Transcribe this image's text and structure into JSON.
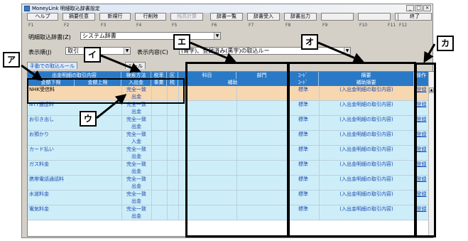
{
  "window": {
    "title": "MoneyLink 明細取込辞書設定"
  },
  "toolbar": {
    "keys": [
      {
        "label": "ヘルプ",
        "fkey": "F1"
      },
      {
        "label": "摘要任意",
        "fkey": "F2"
      },
      {
        "label": "新規行",
        "fkey": "F3"
      },
      {
        "label": "行削除",
        "fkey": "F4"
      },
      {
        "label": "残高計算",
        "fkey": "F5",
        "disabled": true
      },
      {
        "label": "辞書一覧",
        "fkey": "F6"
      },
      {
        "label": "辞書受入",
        "fkey": "F7"
      },
      {
        "label": "辞書出力",
        "fkey": "F8"
      },
      {
        "label": "",
        "fkey": "F9"
      },
      {
        "label": "",
        "fkey": "F10"
      },
      {
        "label": "",
        "fkey": "F11"
      },
      {
        "label": "終了",
        "fkey": "F12"
      }
    ]
  },
  "form": {
    "dict_label": "明細取込辞書(Z)",
    "dict_value": "システム辞書",
    "order_label": "表示順(J)",
    "order_value": "取引",
    "content_label": "表示内容(C)",
    "content_value": "(青字)、登録済み(黒字)の取込ルー"
  },
  "tabs": {
    "tab1": "手動での取込ルール",
    "tab2": "ルール"
  },
  "grid": {
    "header_top": [
      "出金明細の取引内容",
      "検索方法",
      "税率",
      "区",
      "科目",
      "部門",
      "ｺｰﾄﾞ",
      "摘要",
      "操作"
    ],
    "header_bottom": [
      "金額下限",
      "金額上限",
      "入出金",
      "事業",
      "税",
      "補助",
      "ｺｰﾄﾞ",
      "補助摘要"
    ],
    "rows": [
      {
        "name": "NHK受信料",
        "method": "完全一致",
        "io": "出金",
        "code": "標準",
        "desc": "(入出金明細の取引内容)",
        "op": "登録"
      },
      {
        "name": "NTT通話料",
        "method": "完全一致",
        "io": "出金",
        "code": "標準",
        "desc": "(入出金明細の取引内容)",
        "op": "登録"
      },
      {
        "name": "お引き出し",
        "method": "完全一致",
        "io": "出金",
        "code": "標準",
        "desc": "(入出金明細の取引内容)",
        "op": "登録"
      },
      {
        "name": "お預かり",
        "method": "完全一致",
        "io": "入金",
        "code": "標準",
        "desc": "(入出金明細の取引内容)",
        "op": "登録"
      },
      {
        "name": "カード払い",
        "method": "完全一致",
        "io": "出金",
        "code": "標準",
        "desc": "(入出金明細の取引内容)",
        "op": "登録"
      },
      {
        "name": "ガス料金",
        "method": "完全一致",
        "io": "出金",
        "code": "標準",
        "desc": "(入出金明細の取引内容)",
        "op": "登録"
      },
      {
        "name": "携帯電話通話料",
        "method": "完全一致",
        "io": "出金",
        "code": "標準",
        "desc": "(入出金明細の取引内容)",
        "op": "登録"
      },
      {
        "name": "水道料金",
        "method": "完全一致",
        "io": "出金",
        "code": "標準",
        "desc": "(入出金明細の取引内容)",
        "op": "登録"
      },
      {
        "name": "電気料金",
        "method": "完全一致",
        "io": "出金",
        "code": "標準",
        "desc": "(入出金明細の取引内容)",
        "op": "登録"
      }
    ]
  },
  "callouts": {
    "a": "ア",
    "i": "イ",
    "u": "ウ",
    "e": "エ",
    "o": "オ",
    "ka": "カ"
  },
  "colors": {
    "header_blue": "#2a79c7",
    "row_alt": "#cdeef8",
    "selected_row": "#f6d7b0",
    "link_blue": "#1a49b0"
  }
}
